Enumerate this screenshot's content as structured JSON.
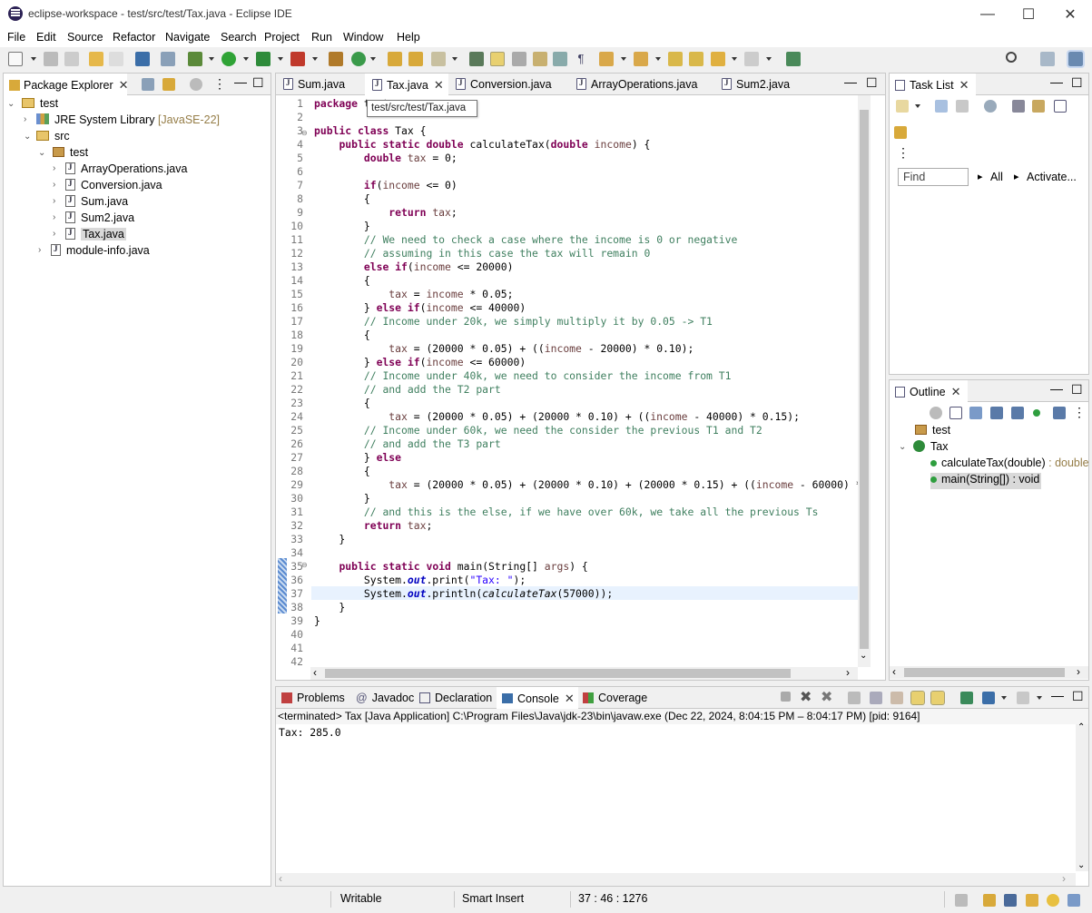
{
  "window": {
    "title": "eclipse-workspace - test/src/test/Tax.java - Eclipse IDE"
  },
  "menu": [
    "File",
    "Edit",
    "Source",
    "Refactor",
    "Navigate",
    "Search",
    "Project",
    "Run",
    "Window",
    "Help"
  ],
  "package_explorer": {
    "tab_label": "Package Explorer",
    "tree": {
      "project": "test",
      "jre": "JRE System Library",
      "jre_version": "[JavaSE-22]",
      "src": "src",
      "package": "test",
      "files": [
        "ArrayOperations.java",
        "Conversion.java",
        "Sum.java",
        "Sum2.java",
        "Tax.java"
      ],
      "module": "module-info.java"
    }
  },
  "editor": {
    "tabs": [
      "Sum.java",
      "Tax.java",
      "Conversion.java",
      "ArrayOperations.java",
      "Sum2.java"
    ],
    "active_tab": "Tax.java",
    "tooltip": "test/src/test/Tax.java",
    "line_numbers": [
      "1",
      "2",
      "3",
      "4",
      "5",
      "6",
      "7",
      "8",
      "9",
      "10",
      "11",
      "12",
      "13",
      "14",
      "15",
      "16",
      "17",
      "18",
      "19",
      "20",
      "21",
      "22",
      "23",
      "24",
      "25",
      "26",
      "27",
      "28",
      "29",
      "30",
      "31",
      "32",
      "33",
      "34",
      "35",
      "36",
      "37",
      "38",
      "39",
      "40",
      "41",
      "42"
    ]
  },
  "task_list": {
    "tab_label": "Task List",
    "find_placeholder": "Find",
    "all_label": "All",
    "activate_label": "Activate..."
  },
  "outline": {
    "tab_label": "Outline",
    "package": "test",
    "class": "Tax",
    "method1_name": "calculateTax(double)",
    "method1_type": " : double",
    "method2": "main(String[]) : void"
  },
  "bottom": {
    "tabs": [
      "Problems",
      "Javadoc",
      "Declaration",
      "Console",
      "Coverage"
    ],
    "active_tab": "Console",
    "console_header": "<terminated> Tax [Java Application] C:\\Program Files\\Java\\jdk-23\\bin\\javaw.exe  (Dec 22, 2024, 8:04:15 PM – 8:04:17 PM) [pid: 9164]",
    "console_output": "Tax: 285.0"
  },
  "status": {
    "writable": "Writable",
    "insert_mode": "Smart Insert",
    "position": "37 : 46 : 1276"
  },
  "colors": {
    "keyword": "#7f0055",
    "comment": "#3f7f5f",
    "string": "#2a00ff",
    "field": "#0000c0",
    "current_line": "#e8f2fe"
  },
  "icons": [
    "new-icon",
    "save-icon",
    "save-all-icon",
    "undo-icon",
    "redo-icon",
    "terminal-icon",
    "debug-icon",
    "run-icon",
    "coverage-icon",
    "external-tools-icon",
    "new-java-project-icon",
    "new-package-icon",
    "new-class-icon",
    "open-type-icon",
    "search-icon",
    "mark-occurrences-icon",
    "next-annotation-icon",
    "prev-annotation-icon",
    "back-icon",
    "forward-icon",
    "open-perspective-icon",
    "java-perspective-icon"
  ]
}
